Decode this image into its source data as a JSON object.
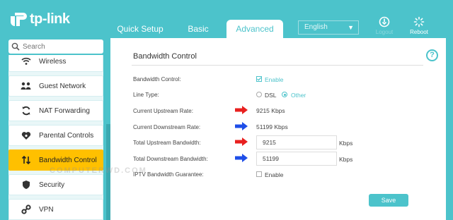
{
  "brand": {
    "logo_text": "tp-link"
  },
  "nav": {
    "tabs": [
      {
        "label": "Quick Setup"
      },
      {
        "label": "Basic"
      },
      {
        "label": "Advanced",
        "active": true
      }
    ],
    "language": "English",
    "logout_label": "Logout",
    "reboot_label": "Reboot"
  },
  "sidebar": {
    "search_placeholder": "Search",
    "items": [
      {
        "label": "Wireless",
        "icon": "wifi-icon"
      },
      {
        "label": "Guest Network",
        "icon": "guest-network-icon"
      },
      {
        "label": "NAT Forwarding",
        "icon": "nat-forwarding-icon"
      },
      {
        "label": "Parental Controls",
        "icon": "parental-controls-icon"
      },
      {
        "label": "Bandwidth Control",
        "icon": "bandwidth-control-icon",
        "active": true
      },
      {
        "label": "Security",
        "icon": "shield-icon"
      },
      {
        "label": "VPN",
        "icon": "vpn-icon"
      }
    ]
  },
  "main": {
    "title": "Bandwidth Control",
    "help_label": "?",
    "bandwidth_control_label": "Bandwidth Control:",
    "enable_label": "Enable",
    "line_type_label": "Line Type:",
    "line_type_options": [
      "DSL",
      "Other"
    ],
    "line_type_selected": "Other",
    "current_upstream_label": "Current Upstream Rate:",
    "current_upstream_value": "9215 Kbps",
    "current_downstream_label": "Current Downstream Rate:",
    "current_downstream_value": "51199 Kbps",
    "total_upstream_label": "Total Upstream Bandwidth:",
    "total_upstream_value": "9215",
    "total_downstream_label": "Total Downstream Bandwidth:",
    "total_downstream_value": "51199",
    "unit_label": "Kbps",
    "iptv_label": "IPTV Bandwidth Guarantee:",
    "iptv_enable_label": "Enable",
    "save_label": "Save",
    "watermark": "COMPUTERWD.COM"
  },
  "colors": {
    "accent": "#4cc3cb",
    "active_item": "#ffc000",
    "arrow_red": "#e8201f",
    "arrow_blue": "#1e4ee8"
  }
}
